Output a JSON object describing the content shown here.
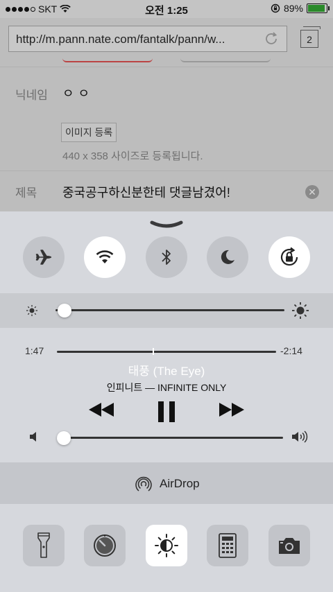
{
  "status_bar": {
    "carrier": "SKT",
    "time": "오전 1:25",
    "battery_percent": "89%"
  },
  "browser": {
    "url": "http://m.pann.nate.com/fantalk/pann/w...",
    "tab_count": "2"
  },
  "form": {
    "nickname_label": "닉네임",
    "nickname_value": "ㅇㅇ",
    "image_button": "이미지 등록",
    "image_hint": "440 x 358 사이즈로 등록됩니다.",
    "title_label": "제목",
    "title_value": "중국공구하신분한테 댓글남겼어!"
  },
  "control_center": {
    "toggles": [
      {
        "name": "airplane-mode",
        "on": false
      },
      {
        "name": "wifi",
        "on": true
      },
      {
        "name": "bluetooth",
        "on": false
      },
      {
        "name": "do-not-disturb",
        "on": false
      },
      {
        "name": "rotation-lock",
        "on": true
      }
    ],
    "brightness_level": 0.04,
    "music": {
      "elapsed": "1:47",
      "remaining": "-2:14",
      "progress": 0.44,
      "song": "태풍 (The Eye)",
      "artist_album": "인피니트 — INFINITE ONLY",
      "volume_level": 0.03
    },
    "airdrop_label": "AirDrop",
    "tools": [
      {
        "name": "flashlight",
        "on": false
      },
      {
        "name": "timer",
        "on": false
      },
      {
        "name": "night-shift",
        "on": true
      },
      {
        "name": "calculator",
        "on": false
      },
      {
        "name": "camera",
        "on": false
      }
    ]
  }
}
